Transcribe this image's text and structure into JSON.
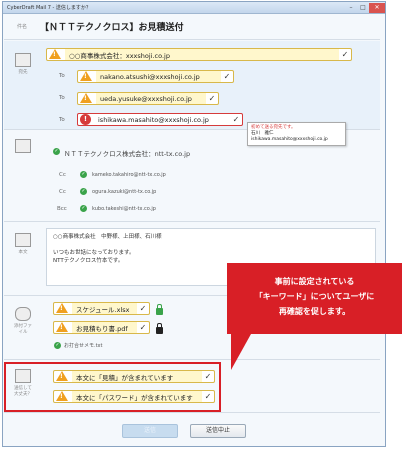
{
  "window": {
    "title": "CyberDraft Mail 7 - 送信しますか？",
    "minimize": "–",
    "maximize": "□",
    "close": "✕"
  },
  "subject": {
    "label": "件名",
    "value": "【ＮＴＴテクノクロス】お見積送付"
  },
  "to_section": {
    "icon_label": "宛先",
    "company": "○○商事株式会社：xxxshoji.co.jp",
    "recipients": [
      {
        "prefix": "To",
        "address": "nakano.atsushi@xxxshoji.co.jp"
      },
      {
        "prefix": "To",
        "address": "ueda.yusuke@xxxshoji.co.jp"
      },
      {
        "prefix": "To",
        "address": "ishikawa.masahito@xxxshoji.co.jp"
      }
    ],
    "tooltip": {
      "line1": "初めて送る宛先です。",
      "line2": "石川　雅仁",
      "line3": "ishikawa.masahito@xxxshoji.co.jp"
    }
  },
  "cc_section": {
    "company": "ＮＴＴテクノクロス株式会社：ntt-tx.co.jp",
    "recipients": [
      {
        "prefix": "Cc",
        "address": "kameko.takahiro@ntt-tx.co.jp"
      },
      {
        "prefix": "Cc",
        "address": "ogura.kazuki@ntt-tx.co.jp"
      },
      {
        "prefix": "Bcc",
        "address": "kubo.takeshi@ntt-tx.co.jp"
      }
    ]
  },
  "body_section": {
    "icon_label": "本文",
    "lines": [
      "○○商事株式会社　中野様、上田様、石川様",
      "",
      "いつもお世話になっております。",
      "NTTテクノクロス竹本です。"
    ]
  },
  "attach_section": {
    "icon_label": "添付ファイル",
    "files": [
      "スケジュール.xlsx",
      "お見積もり書.pdf"
    ],
    "meeting_memo": "お打合せメモ.txt"
  },
  "keyword_section": {
    "icon_label": "送信して大丈夫？",
    "warnings": [
      "本文に「見積」が含まれています",
      "本文に「パスワード」が含まれています"
    ]
  },
  "callout": {
    "line1": "事前に設定されている",
    "line2": "「キーワード」についてユーザに",
    "line3": "再確認を促します。"
  },
  "buttons": {
    "send": "送信",
    "cancel": "送信中止"
  },
  "colors": {
    "accent_red": "#d81f26",
    "warn_orange": "#f0a020",
    "ok_green": "#3aa34a"
  }
}
